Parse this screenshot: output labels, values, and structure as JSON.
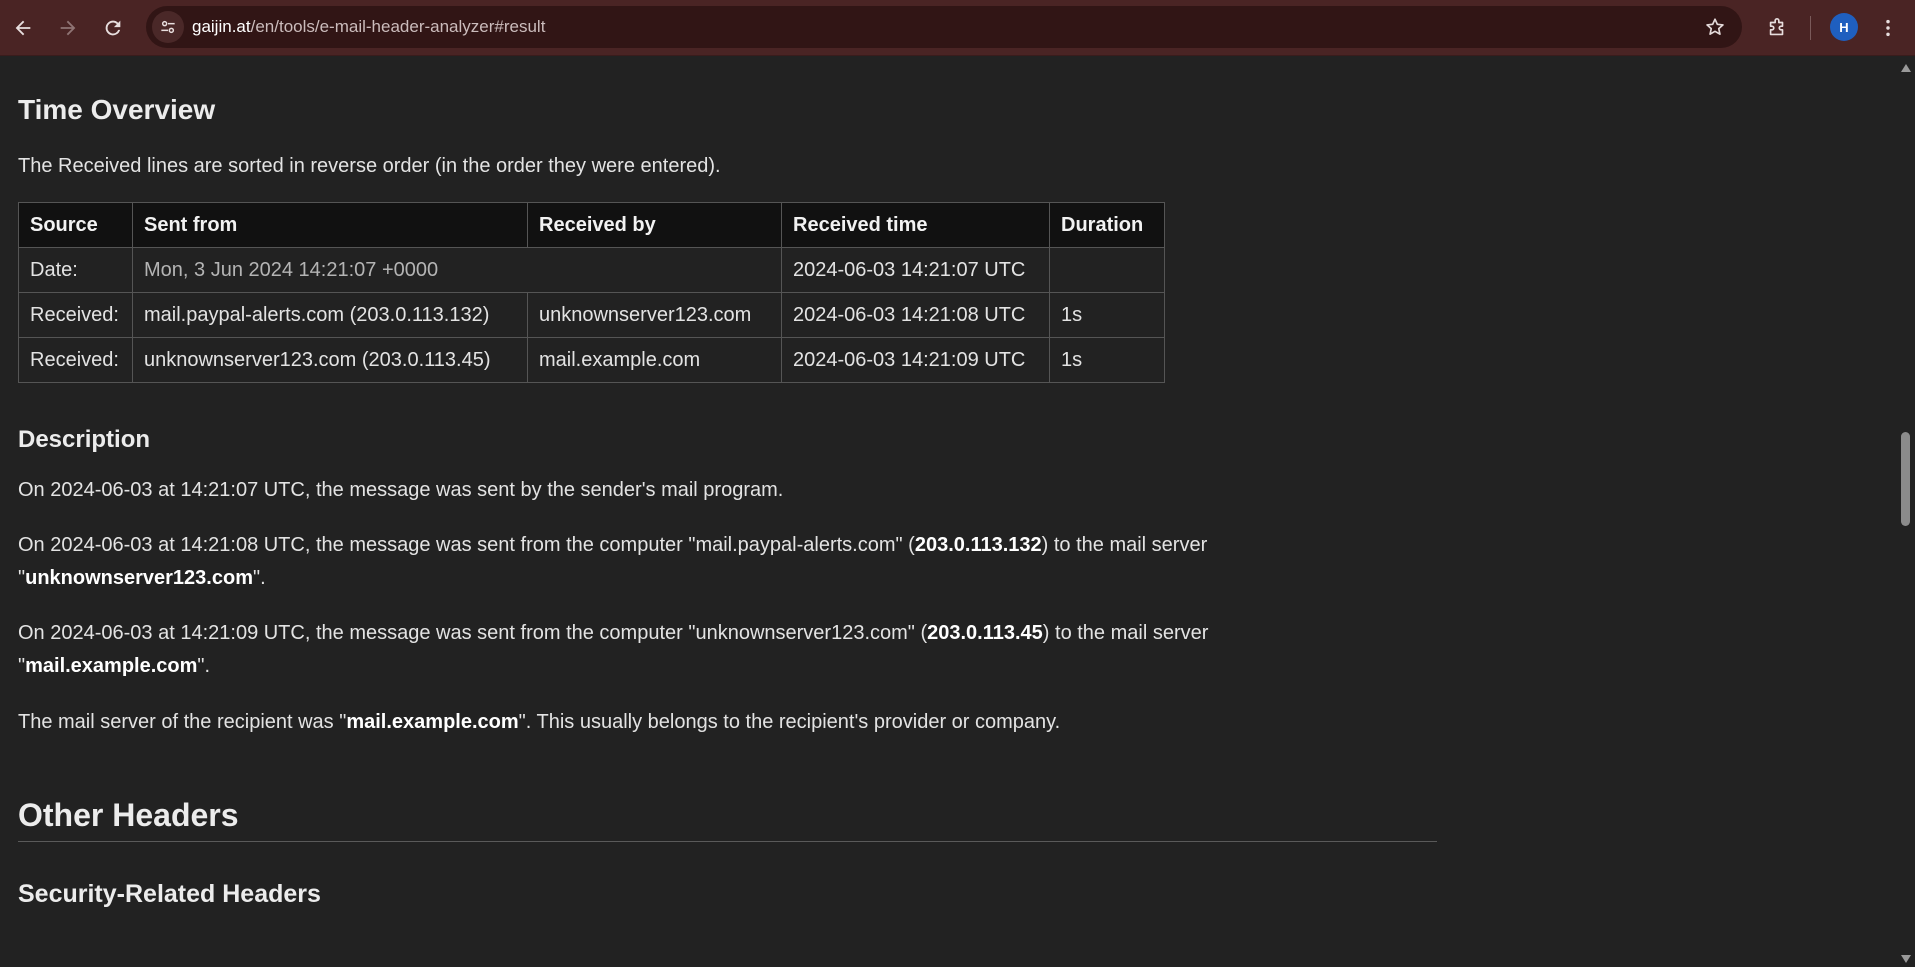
{
  "browser": {
    "url_host": "gaijin.at",
    "url_path": "/en/tools/e-mail-header-analyzer#result",
    "profile_initial": "H"
  },
  "time_overview": {
    "title": "Time Overview",
    "intro": "The Received lines are sorted in reverse order (in the order they were entered).",
    "headers": [
      "Source",
      "Sent from",
      "Received by",
      "Received time",
      "Duration"
    ],
    "rows": [
      {
        "source": "Date:",
        "sent_from": "Mon, 3 Jun 2024 14:21:07 +0000",
        "received_by": "",
        "received_time": "2024-06-03 14:21:07 UTC",
        "duration": ""
      },
      {
        "source": "Received:",
        "sent_from": "mail.paypal-alerts.com (203.0.113.132)",
        "received_by": "unknownserver123.com",
        "received_time": "2024-06-03 14:21:08 UTC",
        "duration": "1s"
      },
      {
        "source": "Received:",
        "sent_from": "unknownserver123.com (203.0.113.45)",
        "received_by": "mail.example.com",
        "received_time": "2024-06-03 14:21:09 UTC",
        "duration": "1s"
      }
    ]
  },
  "description": {
    "title": "Description",
    "line1": "On 2024-06-03 at 14:21:07 UTC, the message was sent by the sender's mail program.",
    "line2": {
      "prefix": "On 2024-06-03 at 14:21:08 UTC, the message was sent from the computer \"mail.paypal-alerts.com\" (",
      "ip": "203.0.113.132",
      "mid": ") to the mail server \"",
      "server": "unknownserver123.com",
      "suffix": "\"."
    },
    "line3": {
      "prefix": "On 2024-06-03 at 14:21:09 UTC, the message was sent from the computer \"unknownserver123.com\" (",
      "ip": "203.0.113.45",
      "mid": ") to the mail server \"",
      "server": "mail.example.com",
      "suffix": "\"."
    },
    "line4": {
      "prefix": "The mail server of the recipient was \"",
      "server": "mail.example.com",
      "suffix": "\". This usually belongs to the recipient's provider or company."
    }
  },
  "other_headers": {
    "title": "Other Headers",
    "security_title": "Security-Related Headers"
  }
}
